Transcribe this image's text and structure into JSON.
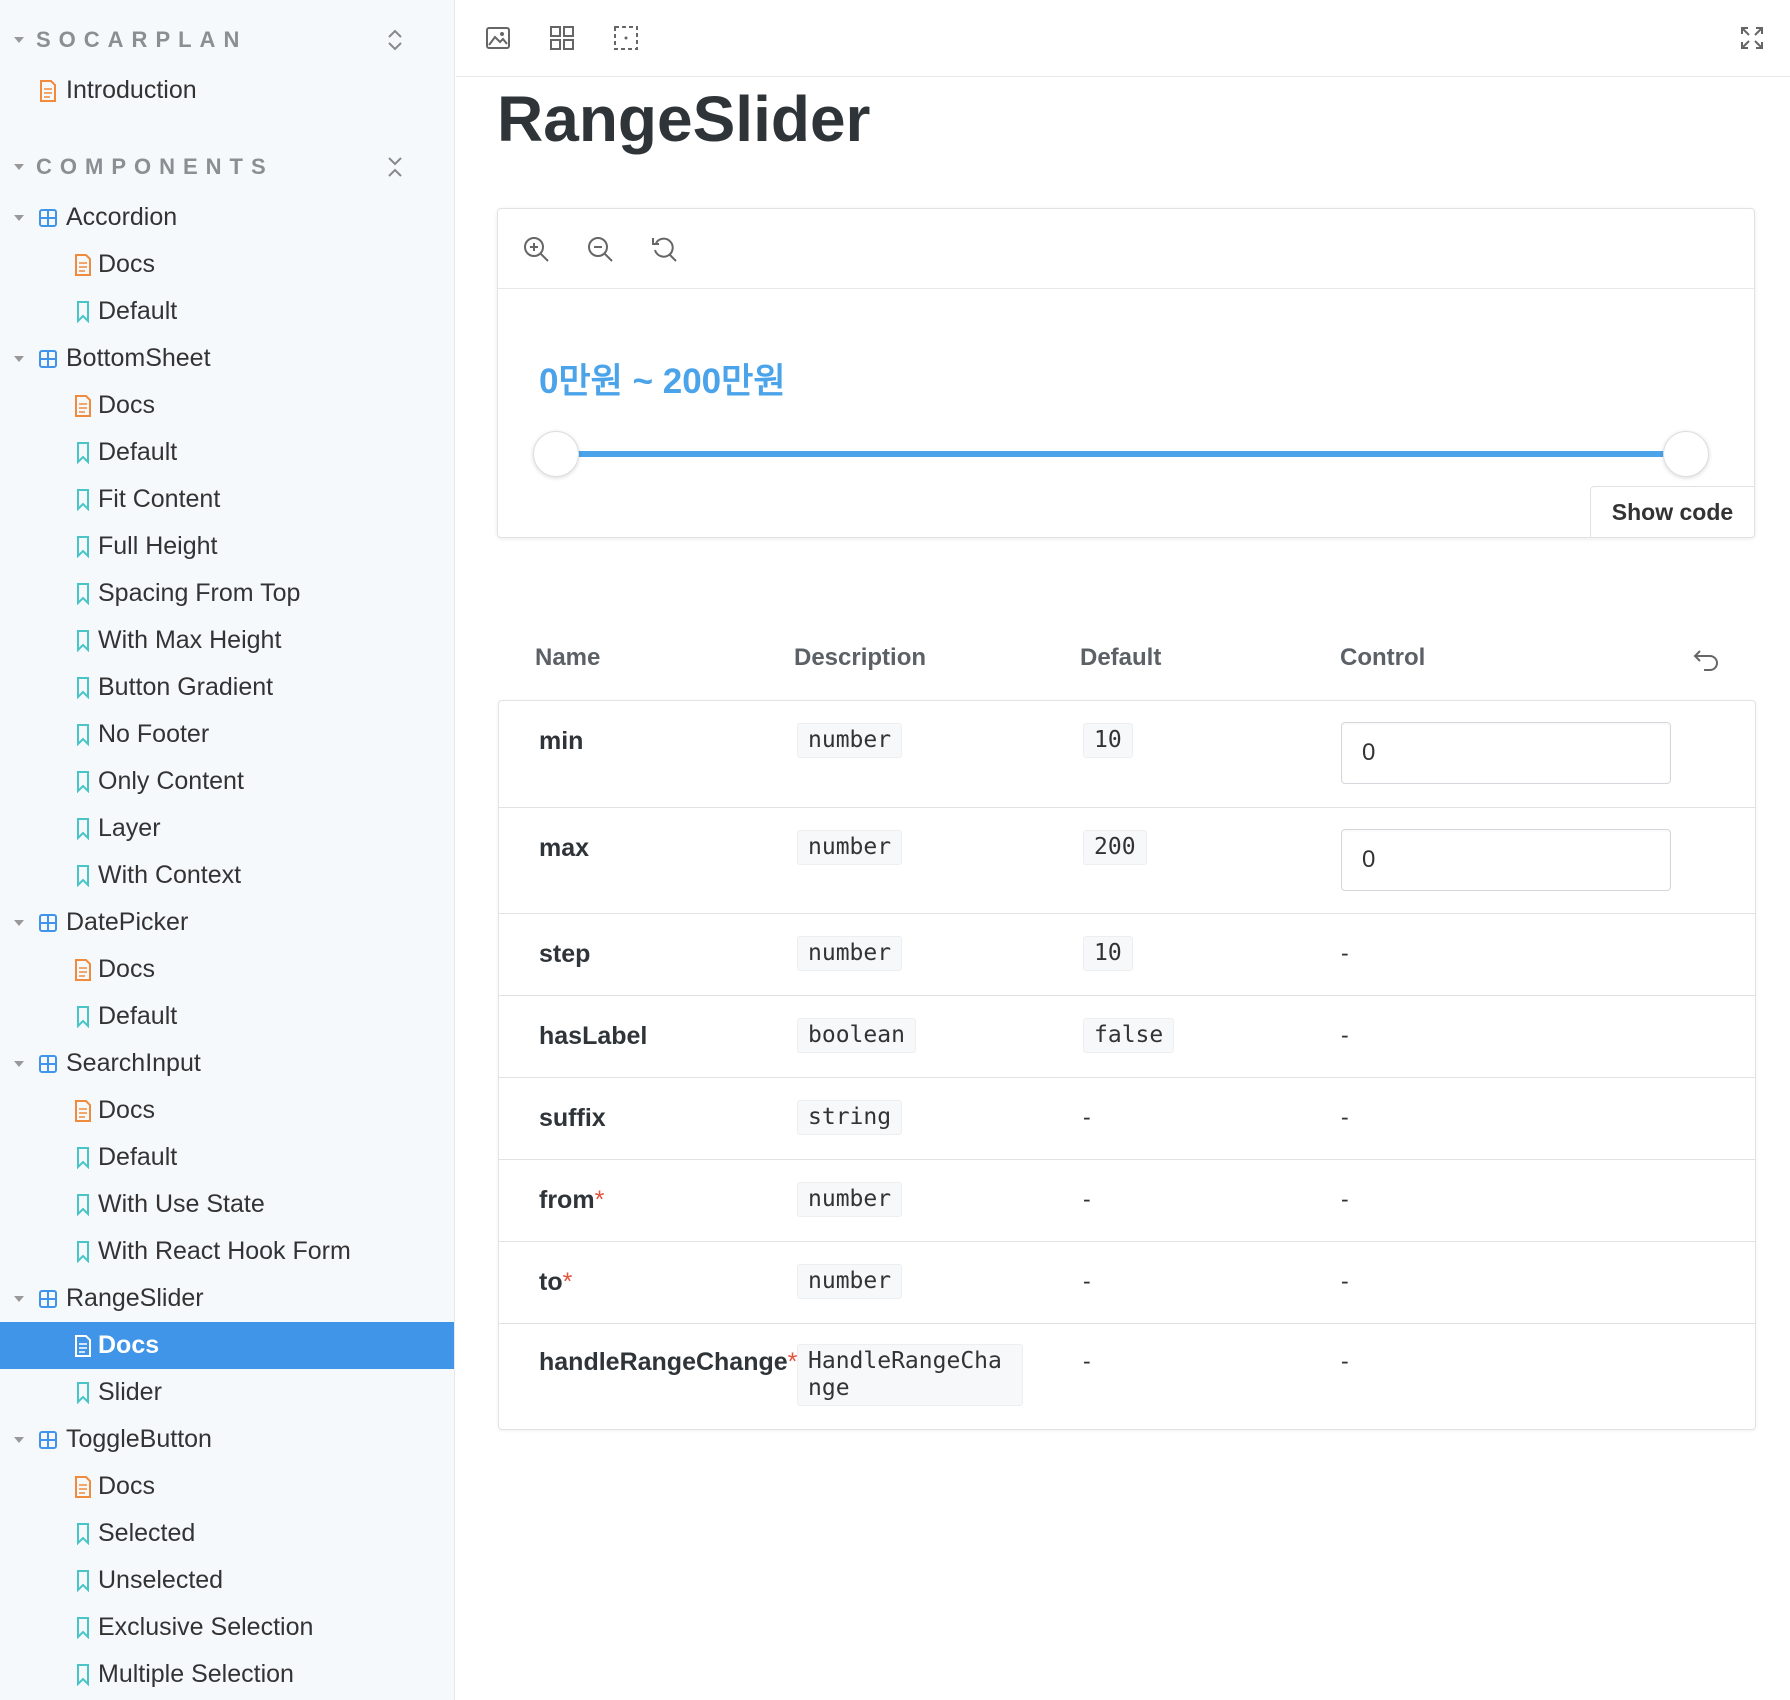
{
  "sidebar": {
    "sections": [
      {
        "title": "SOCARPLAN",
        "toggle_icon": "expand-all-icon"
      },
      {
        "title": "COMPONENTS",
        "toggle_icon": "collapse-all-icon"
      }
    ],
    "items": [
      {
        "label": "Introduction",
        "type": "docs"
      },
      {
        "label": "Accordion",
        "type": "component"
      },
      {
        "label": "Docs",
        "type": "docs"
      },
      {
        "label": "Default",
        "type": "story"
      },
      {
        "label": "BottomSheet",
        "type": "component"
      },
      {
        "label": "Docs",
        "type": "docs"
      },
      {
        "label": "Default",
        "type": "story"
      },
      {
        "label": "Fit Content",
        "type": "story"
      },
      {
        "label": "Full Height",
        "type": "story"
      },
      {
        "label": "Spacing From Top",
        "type": "story"
      },
      {
        "label": "With Max Height",
        "type": "story"
      },
      {
        "label": "Button Gradient",
        "type": "story"
      },
      {
        "label": "No Footer",
        "type": "story"
      },
      {
        "label": "Only Content",
        "type": "story"
      },
      {
        "label": "Layer",
        "type": "story"
      },
      {
        "label": "With Context",
        "type": "story"
      },
      {
        "label": "DatePicker",
        "type": "component"
      },
      {
        "label": "Docs",
        "type": "docs"
      },
      {
        "label": "Default",
        "type": "story"
      },
      {
        "label": "SearchInput",
        "type": "component"
      },
      {
        "label": "Docs",
        "type": "docs"
      },
      {
        "label": "Default",
        "type": "story"
      },
      {
        "label": "With Use State",
        "type": "story"
      },
      {
        "label": "With React Hook Form",
        "type": "story"
      },
      {
        "label": "RangeSlider",
        "type": "component"
      },
      {
        "label": "Docs",
        "type": "docs",
        "selected": true
      },
      {
        "label": "Slider",
        "type": "story"
      },
      {
        "label": "ToggleButton",
        "type": "component"
      },
      {
        "label": "Docs",
        "type": "docs"
      },
      {
        "label": "Selected",
        "type": "story"
      },
      {
        "label": "Unselected",
        "type": "story"
      },
      {
        "label": "Exclusive Selection",
        "type": "story"
      },
      {
        "label": "Multiple Selection",
        "type": "story"
      }
    ]
  },
  "toolbar": {
    "left_icons": [
      "image-icon",
      "grid-icon",
      "outline-icon"
    ],
    "right_icons": [
      "fullscreen-icon"
    ]
  },
  "page": {
    "title": "RangeSlider"
  },
  "preview": {
    "zoom_icons": [
      "zoom-in-icon",
      "zoom-out-icon",
      "reset-zoom-icon"
    ],
    "range_label": "0만원 ~ 200만원",
    "slider": {
      "from": 0,
      "to": 200,
      "max": 200
    },
    "show_code_label": "Show code"
  },
  "args_table": {
    "headers": {
      "name": "Name",
      "description": "Description",
      "default": "Default",
      "control": "Control"
    },
    "rows": [
      {
        "name": "min",
        "required": false,
        "type": "number",
        "default": "10",
        "control": "0"
      },
      {
        "name": "max",
        "required": false,
        "type": "number",
        "default": "200",
        "control": "0"
      },
      {
        "name": "step",
        "required": false,
        "type": "number",
        "default": "10",
        "control": "-"
      },
      {
        "name": "hasLabel",
        "required": false,
        "type": "boolean",
        "default": "false",
        "control": "-"
      },
      {
        "name": "suffix",
        "required": false,
        "type": "string",
        "default": "-",
        "control": "-"
      },
      {
        "name": "from",
        "required": true,
        "type": "number",
        "default": "-",
        "control": "-"
      },
      {
        "name": "to",
        "required": true,
        "type": "number",
        "default": "-",
        "control": "-"
      },
      {
        "name": "handleRangeChange",
        "required": true,
        "type": "HandleRangeChange",
        "default": "-",
        "control": "-"
      }
    ],
    "required_mark": "*"
  },
  "colors": {
    "accent": "#4ba3ea",
    "selected_bg": "#4095e8",
    "docs_icon": "#f08a3c",
    "story_icon": "#49c5c8",
    "component_icon": "#4095e8",
    "required": "#e5533d"
  }
}
